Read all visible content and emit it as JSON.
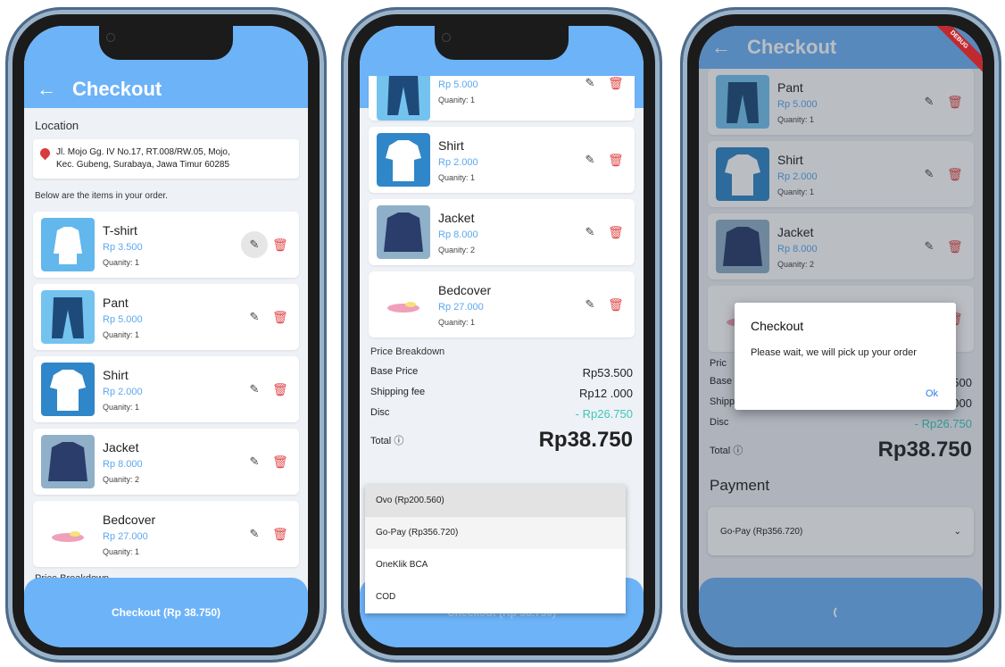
{
  "app": {
    "title": "Checkout",
    "back_icon": "arrow-back-icon",
    "accent_color": "#6db3f8"
  },
  "screen1": {
    "location_label": "Location",
    "address_line1": "Jl. Mojo Gg. IV No.17, RT.008/RW.05, Mojo,",
    "address_line2": "Kec. Gubeng, Surabaya, Jawa Timur 60285",
    "items_note": "Below are the items in your order.",
    "items": [
      {
        "name": "T-shirt",
        "price": "Rp 3.500",
        "qty": "Quanity: 1"
      },
      {
        "name": "Pant",
        "price": "Rp 5.000",
        "qty": "Quanity: 1"
      },
      {
        "name": "Shirt",
        "price": "Rp 2.000",
        "qty": "Quanity: 1"
      },
      {
        "name": "Jacket",
        "price": "Rp 8.000",
        "qty": "Quanity: 2"
      },
      {
        "name": "Bedcover",
        "price": "Rp 27.000",
        "qty": "Quanity: 1"
      }
    ],
    "price_breakdown_label": "Price Breakdown",
    "checkout_button": "Checkout (Rp 38.750)"
  },
  "screen2": {
    "items": [
      {
        "name": "",
        "price": "Rp 5.000",
        "qty": "Quanity: 1"
      },
      {
        "name": "Shirt",
        "price": "Rp 2.000",
        "qty": "Quanity: 1"
      },
      {
        "name": "Jacket",
        "price": "Rp 8.000",
        "qty": "Quanity: 2"
      },
      {
        "name": "Bedcover",
        "price": "Rp 27.000",
        "qty": "Quanity: 1"
      }
    ],
    "breakdown": {
      "title": "Price Breakdown",
      "base_label": "Base Price",
      "base_value": "Rp53.500",
      "ship_label": "Shipping fee",
      "ship_value": "Rp12 .000",
      "disc_label": "Disc",
      "disc_value": "- Rp26.750",
      "total_label": "Total",
      "total_value": "Rp38.750"
    },
    "payment_options": [
      "Ovo (Rp200.560)",
      "Go-Pay (Rp356.720)",
      "OneKlik BCA",
      "COD"
    ],
    "checkout_button": "Checkout (Rp 38.750)"
  },
  "screen3": {
    "items": [
      {
        "name": "Pant",
        "price": "Rp 5.000",
        "qty": "Quanity: 1"
      },
      {
        "name": "Shirt",
        "price": "Rp 2.000",
        "qty": "Quanity: 1"
      },
      {
        "name": "Jacket",
        "price": "Rp 8.000",
        "qty": "Quanity: 2"
      }
    ],
    "breakdown": {
      "price_partial": "Pric",
      "base_partial": "Base",
      "base_value_partial": "500",
      "ship_label": "Shipping fee",
      "ship_value": "Rp12 .000",
      "disc_label": "Disc",
      "disc_value": "- Rp26.750",
      "total_label": "Total",
      "total_value": "Rp38.750"
    },
    "payment_title": "Payment",
    "payment_selected": "Go-Pay (Rp356.720)",
    "debug_banner": "DEBUG",
    "dialog": {
      "title": "Checkout",
      "message": "Please wait, we will pick up your order",
      "ok": "Ok"
    }
  }
}
